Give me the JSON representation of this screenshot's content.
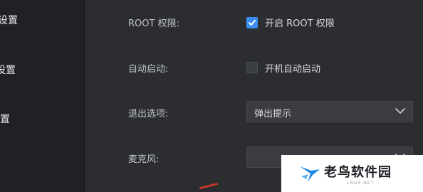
{
  "sidebar": {
    "items": [
      {
        "label": "设置"
      },
      {
        "label": "设置"
      },
      {
        "label": "置"
      }
    ]
  },
  "settings": {
    "root": {
      "label": "ROOT 权限:",
      "checkbox_label": "开启 ROOT 权限",
      "checked": true
    },
    "autostart": {
      "label": "自动启动:",
      "checkbox_label": "开机自动启动",
      "checked": false
    },
    "exit": {
      "label": "退出选项:",
      "value": "弹出提示"
    },
    "mic": {
      "label": "麦克风:",
      "value": ""
    }
  },
  "watermark": {
    "text": "老鸟软件园",
    "sub": "LNGS.NET"
  },
  "colors": {
    "accent": "#3b8ff3",
    "background": "#2b2d30",
    "sidebar": "#202124"
  }
}
